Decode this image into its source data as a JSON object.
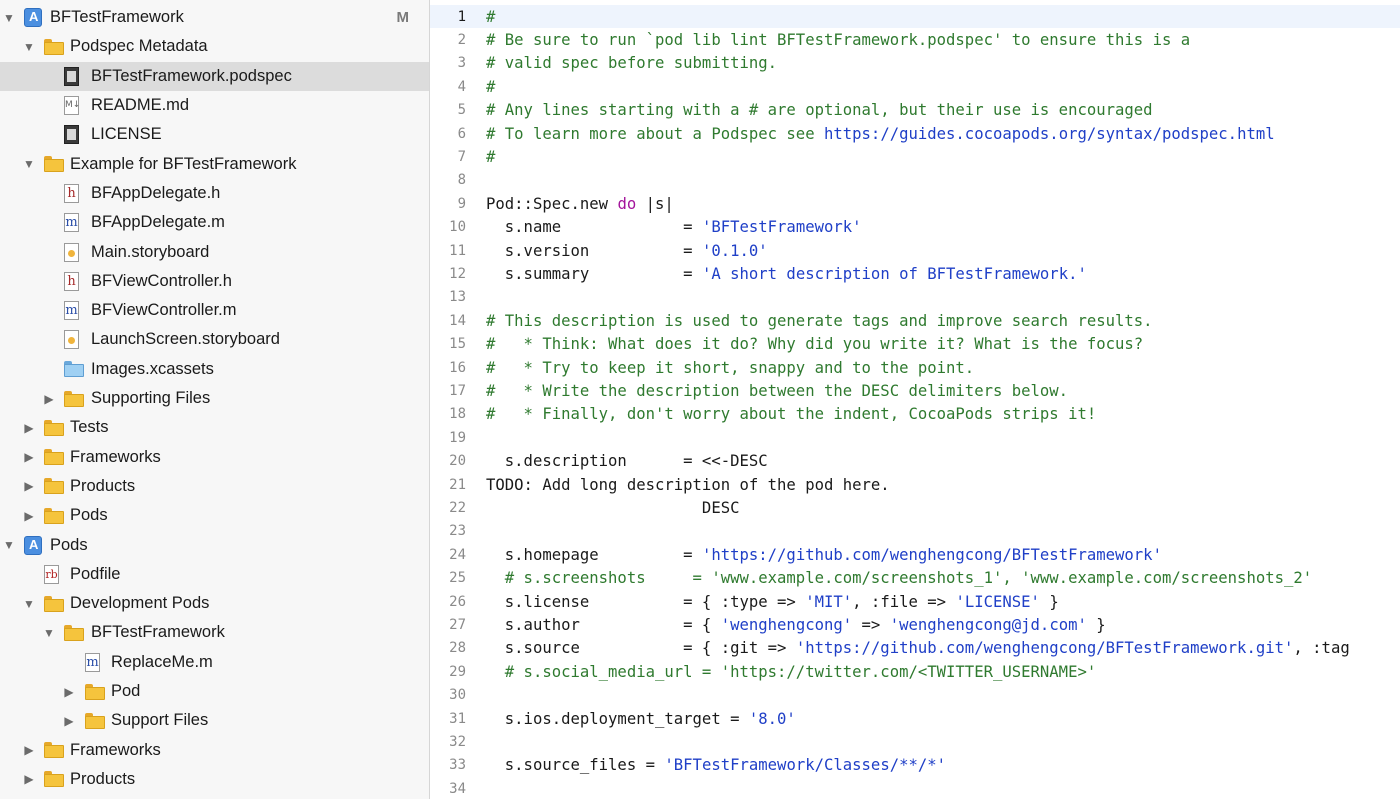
{
  "navigator": {
    "items": [
      {
        "label": "BFTestFramework",
        "icon": "xcode-project-icon",
        "depth": 0,
        "disclosure": "open",
        "badge": "M"
      },
      {
        "label": "Podspec Metadata",
        "icon": "folder-icon",
        "depth": 1,
        "disclosure": "open"
      },
      {
        "label": "BFTestFramework.podspec",
        "icon": "podspec-file-icon",
        "depth": 2,
        "disclosure": "none",
        "selected": true
      },
      {
        "label": "README.md",
        "icon": "markdown-file-icon",
        "depth": 2,
        "disclosure": "none"
      },
      {
        "label": "LICENSE",
        "icon": "text-file-icon",
        "depth": 2,
        "disclosure": "none"
      },
      {
        "label": "Example for BFTestFramework",
        "icon": "folder-icon",
        "depth": 1,
        "disclosure": "open"
      },
      {
        "label": "BFAppDelegate.h",
        "icon": "header-file-icon",
        "depth": 2,
        "disclosure": "none"
      },
      {
        "label": "BFAppDelegate.m",
        "icon": "objc-file-icon",
        "depth": 2,
        "disclosure": "none"
      },
      {
        "label": "Main.storyboard",
        "icon": "storyboard-file-icon",
        "depth": 2,
        "disclosure": "none"
      },
      {
        "label": "BFViewController.h",
        "icon": "header-file-icon",
        "depth": 2,
        "disclosure": "none"
      },
      {
        "label": "BFViewController.m",
        "icon": "objc-file-icon",
        "depth": 2,
        "disclosure": "none"
      },
      {
        "label": "LaunchScreen.storyboard",
        "icon": "storyboard-file-icon",
        "depth": 2,
        "disclosure": "none"
      },
      {
        "label": "Images.xcassets",
        "icon": "asset-catalog-icon",
        "depth": 2,
        "disclosure": "none"
      },
      {
        "label": "Supporting Files",
        "icon": "folder-icon",
        "depth": 2,
        "disclosure": "closed"
      },
      {
        "label": "Tests",
        "icon": "folder-icon",
        "depth": 1,
        "disclosure": "closed"
      },
      {
        "label": "Frameworks",
        "icon": "folder-icon",
        "depth": 1,
        "disclosure": "closed"
      },
      {
        "label": "Products",
        "icon": "folder-icon",
        "depth": 1,
        "disclosure": "closed"
      },
      {
        "label": "Pods",
        "icon": "folder-icon",
        "depth": 1,
        "disclosure": "closed"
      },
      {
        "label": "Pods",
        "icon": "xcode-project-icon",
        "depth": 0,
        "disclosure": "open"
      },
      {
        "label": "Podfile",
        "icon": "ruby-file-icon",
        "depth": 1,
        "disclosure": "none"
      },
      {
        "label": "Development Pods",
        "icon": "folder-icon",
        "depth": 1,
        "disclosure": "open"
      },
      {
        "label": "BFTestFramework",
        "icon": "folder-icon",
        "depth": 2,
        "disclosure": "open"
      },
      {
        "label": "ReplaceMe.m",
        "icon": "objc-file-icon",
        "depth": 3,
        "disclosure": "none"
      },
      {
        "label": "Pod",
        "icon": "folder-icon",
        "depth": 3,
        "disclosure": "closed"
      },
      {
        "label": "Support Files",
        "icon": "folder-icon",
        "depth": 3,
        "disclosure": "closed"
      },
      {
        "label": "Frameworks",
        "icon": "folder-icon",
        "depth": 1,
        "disclosure": "closed"
      },
      {
        "label": "Products",
        "icon": "folder-icon",
        "depth": 1,
        "disclosure": "closed"
      }
    ]
  },
  "editor": {
    "current_line": 1,
    "lines": [
      [
        [
          "comment",
          "#"
        ]
      ],
      [
        [
          "comment",
          "# Be sure to run `pod lib lint BFTestFramework.podspec' to ensure this is a"
        ]
      ],
      [
        [
          "comment",
          "# valid spec before submitting."
        ]
      ],
      [
        [
          "comment",
          "#"
        ]
      ],
      [
        [
          "comment",
          "# Any lines starting with a # are optional, but their use is encouraged"
        ]
      ],
      [
        [
          "comment",
          "# To learn more about a Podspec see "
        ],
        [
          "url",
          "https://guides.cocoapods.org/syntax/podspec.html"
        ]
      ],
      [
        [
          "comment",
          "#"
        ]
      ],
      [],
      [
        [
          "plain",
          "Pod::Spec.new "
        ],
        [
          "keyword",
          "do"
        ],
        [
          "plain",
          " |s|"
        ]
      ],
      [
        [
          "plain",
          "  s.name             = "
        ],
        [
          "string",
          "'BFTestFramework'"
        ]
      ],
      [
        [
          "plain",
          "  s.version          = "
        ],
        [
          "string",
          "'0.1.0'"
        ]
      ],
      [
        [
          "plain",
          "  s.summary          = "
        ],
        [
          "string",
          "'A short description of BFTestFramework.'"
        ]
      ],
      [],
      [
        [
          "comment",
          "# This description is used to generate tags and improve search results."
        ]
      ],
      [
        [
          "comment",
          "#   * Think: What does it do? Why did you write it? What is the focus?"
        ]
      ],
      [
        [
          "comment",
          "#   * Try to keep it short, snappy and to the point."
        ]
      ],
      [
        [
          "comment",
          "#   * Write the description between the DESC delimiters below."
        ]
      ],
      [
        [
          "comment",
          "#   * Finally, don't worry about the indent, CocoaPods strips it!"
        ]
      ],
      [],
      [
        [
          "plain",
          "  s.description      = <<-DESC"
        ]
      ],
      [
        [
          "plain",
          "TODO: Add long description of the pod here."
        ]
      ],
      [
        [
          "plain",
          "                       DESC"
        ]
      ],
      [],
      [
        [
          "plain",
          "  s.homepage         = "
        ],
        [
          "string",
          "'https://github.com/wenghengcong/BFTestFramework'"
        ]
      ],
      [
        [
          "comment",
          "  # s.screenshots     = 'www.example.com/screenshots_1', 'www.example.com/screenshots_2'"
        ]
      ],
      [
        [
          "plain",
          "  s.license          = { :type => "
        ],
        [
          "string",
          "'MIT'"
        ],
        [
          "plain",
          ", :file => "
        ],
        [
          "string",
          "'LICENSE'"
        ],
        [
          "plain",
          " }"
        ]
      ],
      [
        [
          "plain",
          "  s.author           = { "
        ],
        [
          "string",
          "'wenghengcong'"
        ],
        [
          "plain",
          " => "
        ],
        [
          "string",
          "'wenghengcong@jd.com'"
        ],
        [
          "plain",
          " }"
        ]
      ],
      [
        [
          "plain",
          "  s.source           = { :git => "
        ],
        [
          "string",
          "'https://github.com/wenghengcong/BFTestFramework.git'"
        ],
        [
          "plain",
          ", :tag"
        ]
      ],
      [
        [
          "comment",
          "  # s.social_media_url = 'https://twitter.com/<TWITTER_USERNAME>'"
        ]
      ],
      [],
      [
        [
          "plain",
          "  s.ios.deployment_target = "
        ],
        [
          "string",
          "'8.0'"
        ]
      ],
      [],
      [
        [
          "plain",
          "  s.source_files = "
        ],
        [
          "string",
          "'BFTestFramework/Classes/**/*'"
        ]
      ],
      []
    ]
  }
}
